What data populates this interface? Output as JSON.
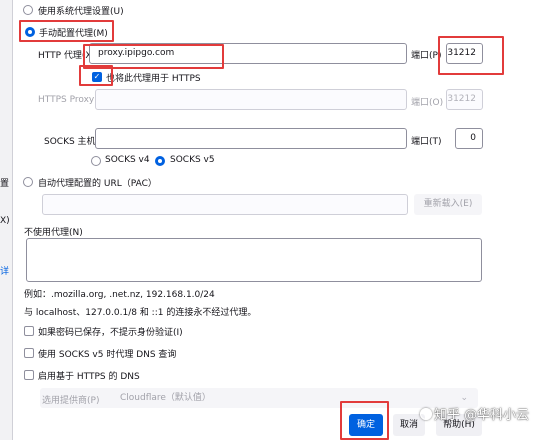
{
  "left_edge": {
    "glyphs": [
      "置",
      "X)",
      "详"
    ]
  },
  "proxy_modes": {
    "system": "使用系统代理设置(U)",
    "manual": "手动配置代理(M)",
    "pac": "自动代理配置的 URL（PAC）"
  },
  "http": {
    "label": "HTTP 代理(X)",
    "value": "proxy.ipipgo.com",
    "port_label": "端口(P)",
    "port": "31212"
  },
  "also_https": "也将此代理用于 HTTPS",
  "https": {
    "label": "HTTPS Proxy",
    "port_label": "端口(O)",
    "port": "31212"
  },
  "socks": {
    "label": "SOCKS 主机",
    "port_label": "端口(T)",
    "port": "0",
    "v4": "SOCKS v4",
    "v5": "SOCKS v5"
  },
  "reload_button": "重新载入(E)",
  "no_proxy": {
    "label": "不使用代理(N)",
    "example": "例如：.mozilla.org, .net.nz, 192.168.1.0/24",
    "note": "与 localhost、127.0.0.1/8 和 ::1 的连接永不经过代理。"
  },
  "options": {
    "no_auth_prompt": "如果密码已保存，不提示身份验证(I)",
    "socks_dns": "使用 SOCKS v5 时代理 DNS 查询",
    "doh": "启用基于 HTTPS 的 DNS"
  },
  "provider": {
    "label": "选用提供商(P)",
    "value": "Cloudflare（默认值）"
  },
  "buttons": {
    "ok": "确定",
    "cancel": "取消",
    "help": "帮助(H)"
  },
  "watermark": "知乎 @华科小云",
  "colors": {
    "accent": "#0061e0",
    "highlight": "#e23b3b"
  }
}
